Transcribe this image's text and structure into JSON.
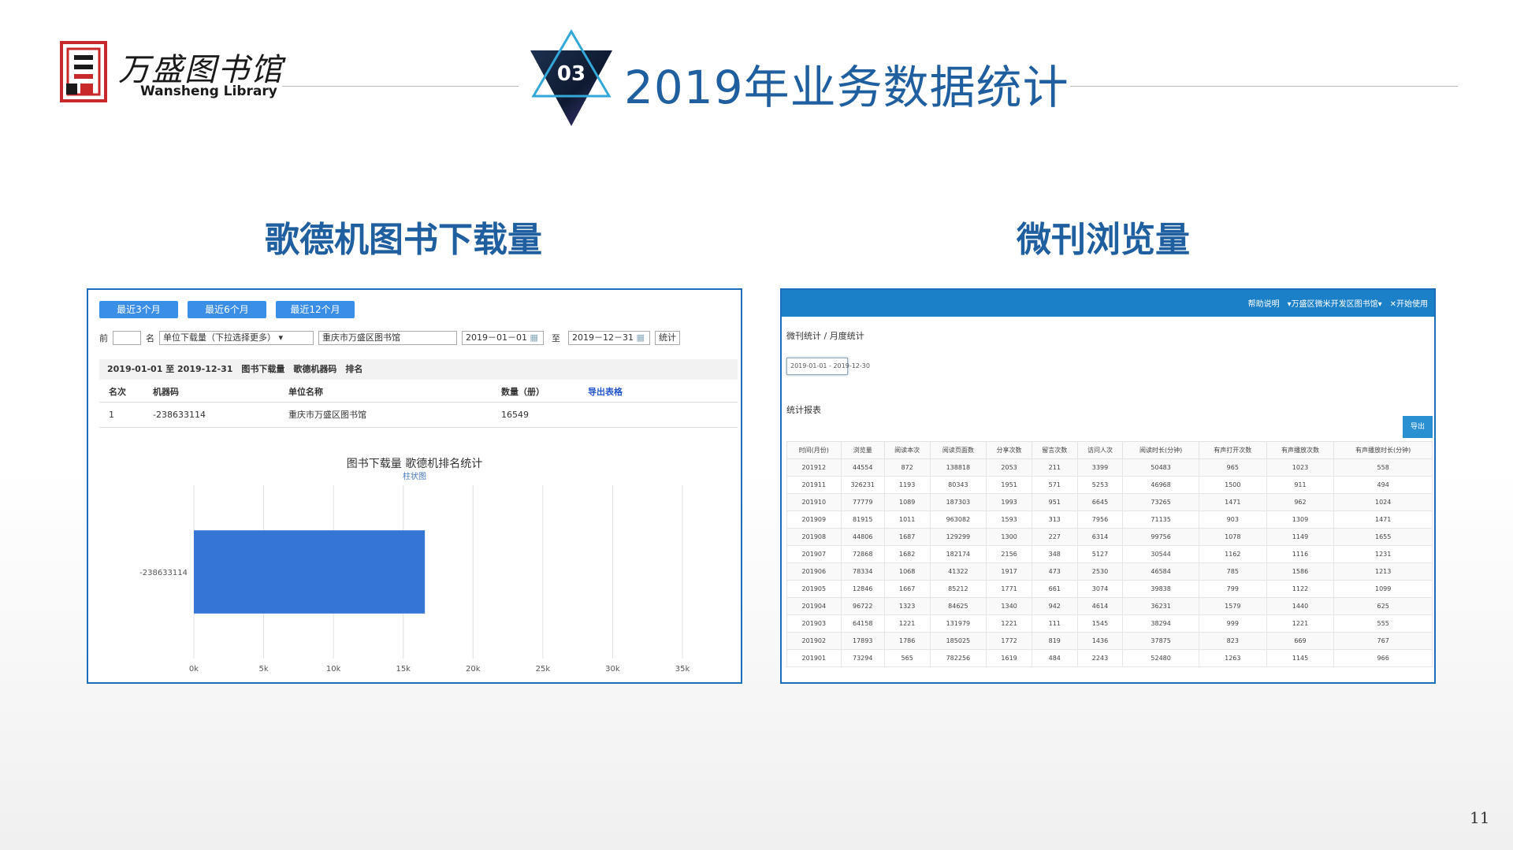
{
  "header": {
    "logo_chinese": "万盛图书馆",
    "logo_english": "Wansheng Library",
    "section_number": "03",
    "title": "2019年业务数据统计"
  },
  "sections": {
    "left_title": "歌德机图书下载量",
    "right_title": "微刊浏览量"
  },
  "page_number": "11",
  "left_panel": {
    "buttons": [
      "最近3个月",
      "最近6个月",
      "最近12个月"
    ],
    "filter": {
      "prefix": "前",
      "top_n_value": "",
      "name_label": "名",
      "unit_select": "单位下载量（下拉选择更多）",
      "library_value": "重庆市万盛区图书馆",
      "start_date": "2019－01－01",
      "to_label": "至",
      "end_date": "2019－12－31",
      "stats_button": "统计"
    },
    "summary": "2019-01-01 至 2019-12-31　图书下载量　歌德机器码　排名",
    "table": {
      "headers": [
        "名次",
        "机器码",
        "单位名称",
        "数量（册）"
      ],
      "export_label": "导出表格",
      "rows": [
        [
          "1",
          "-238633114",
          "重庆市万盛区图书馆",
          "16549"
        ]
      ]
    },
    "chart_data": {
      "type": "bar",
      "orientation": "horizontal",
      "title": "图书下载量 歌德机排名统计",
      "subtitle": "柱状图",
      "categories": [
        "-238633114"
      ],
      "values": [
        16549
      ],
      "xlim": [
        0,
        35000
      ],
      "x_ticks": [
        "0k",
        "5k",
        "10k",
        "15k",
        "20k",
        "25k",
        "30k",
        "35k"
      ],
      "grid": true,
      "color": "#3575d3"
    }
  },
  "right_panel": {
    "topbar_text": "帮助说明　▾万盛区微米开发区图书馆▾　✕开始使用",
    "breadcrumb": "微刊统计 / 月度统计",
    "date_range": "2019-01-01 - 2019-12-30",
    "list_label": "统计报表",
    "export_button": "导出excel",
    "headers": [
      "时间(月份)",
      "浏览量",
      "阅读本次",
      "阅读页面数",
      "分享次数",
      "留言次数",
      "访问人次",
      "阅读时长(分钟)",
      "有声打开次数",
      "有声播放次数",
      "有声播放时长(分钟)"
    ],
    "rows": [
      [
        "201912",
        "44554",
        "872",
        "138818",
        "2053",
        "211",
        "3399",
        "50483",
        "965",
        "1023",
        "558"
      ],
      [
        "201911",
        "326231",
        "1193",
        "80343",
        "1951",
        "571",
        "5253",
        "46968",
        "1500",
        "911",
        "494"
      ],
      [
        "201910",
        "77779",
        "1089",
        "187303",
        "1993",
        "951",
        "6645",
        "73265",
        "1471",
        "962",
        "1024"
      ],
      [
        "201909",
        "81915",
        "1011",
        "963082",
        "1593",
        "313",
        "7956",
        "71135",
        "903",
        "1309",
        "1471"
      ],
      [
        "201908",
        "44806",
        "1687",
        "129299",
        "1300",
        "227",
        "6314",
        "99756",
        "1078",
        "1149",
        "1655"
      ],
      [
        "201907",
        "72868",
        "1682",
        "182174",
        "2156",
        "348",
        "5127",
        "30544",
        "1162",
        "1116",
        "1231"
      ],
      [
        "201906",
        "78334",
        "1068",
        "41322",
        "1917",
        "473",
        "2530",
        "46584",
        "785",
        "1586",
        "1213"
      ],
      [
        "201905",
        "12846",
        "1667",
        "85212",
        "1771",
        "661",
        "3074",
        "39838",
        "799",
        "1122",
        "1099"
      ],
      [
        "201904",
        "96722",
        "1323",
        "84625",
        "1340",
        "942",
        "4614",
        "36231",
        "1579",
        "1440",
        "625"
      ],
      [
        "201903",
        "64158",
        "1221",
        "131979",
        "1221",
        "111",
        "1545",
        "38294",
        "999",
        "1221",
        "555"
      ],
      [
        "201902",
        "17893",
        "1786",
        "185025",
        "1772",
        "819",
        "1436",
        "37875",
        "823",
        "669",
        "767"
      ],
      [
        "201901",
        "73294",
        "565",
        "782256",
        "1619",
        "484",
        "2243",
        "52480",
        "1263",
        "1145",
        "966"
      ]
    ]
  },
  "colors": {
    "title_blue": "#1f5fa0",
    "panel_border": "#1c6eb8",
    "bar_blue": "#3575d3",
    "topbar_blue": "#1c80c8",
    "logo_red": "#c8282a"
  }
}
